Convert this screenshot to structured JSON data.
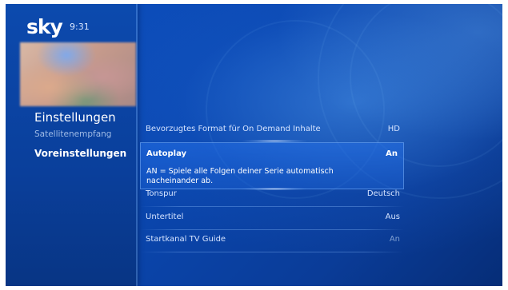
{
  "header": {
    "logo": "sky",
    "time": "9:31"
  },
  "nav": {
    "title": "Einstellungen",
    "items": [
      {
        "label": "Satellitenempfang",
        "active": false
      },
      {
        "label": "Voreinstellungen",
        "active": true
      }
    ]
  },
  "settings": [
    {
      "label": "Bevorzugtes Format für On Demand Inhalte",
      "value": "HD"
    },
    {
      "label": "Autoplay",
      "value": "An",
      "description": "AN = Spiele alle Folgen deiner Serie automatisch nacheinander ab."
    },
    {
      "label": "Tonspur",
      "value": "Deutsch"
    },
    {
      "label": "Untertitel",
      "value": "Aus"
    },
    {
      "label": "Startkanal TV Guide",
      "value": "An"
    }
  ]
}
